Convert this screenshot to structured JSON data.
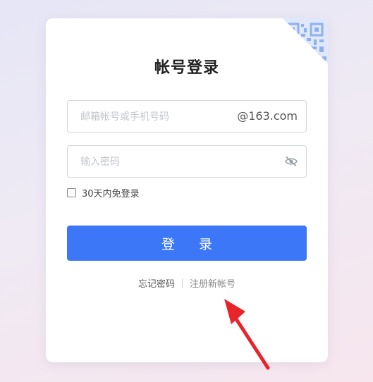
{
  "login": {
    "title": "帐号登录",
    "email_placeholder": "邮箱帐号或手机号码",
    "email_suffix": "@163.com",
    "password_placeholder": "输入密码",
    "remember_label": "30天内免登录",
    "login_button": "登 录",
    "forgot_password": "忘记密码",
    "register": "注册新帐号"
  },
  "colors": {
    "primary": "#3c77f7",
    "qr_accent": "#8fb0f0",
    "annotation_arrow": "#e8242a"
  },
  "icons": {
    "qr_corner": "qr-code-icon",
    "password_toggle": "eye-slash-icon",
    "annotation": "red-arrow-icon"
  }
}
